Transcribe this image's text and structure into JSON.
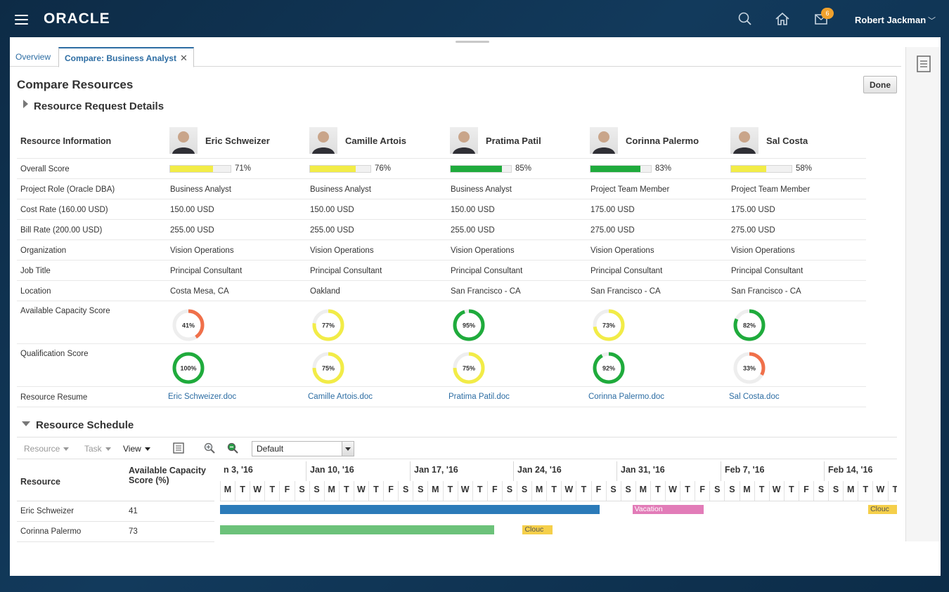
{
  "header": {
    "logo": "ORACLE",
    "notification_count": "6",
    "user_name": "Robert Jackman"
  },
  "tabs": [
    {
      "label": "Overview",
      "active": false
    },
    {
      "label": "Compare: Business Analyst",
      "active": true
    }
  ],
  "page": {
    "title": "Compare Resources",
    "done_label": "Done",
    "request_section": "Resource Request Details",
    "schedule_section": "Resource Schedule"
  },
  "compare": {
    "header_label": "Resource Information",
    "row_labels": {
      "overall": "Overall Score",
      "role": "Project Role (Oracle DBA)",
      "cost": "Cost Rate (160.00 USD)",
      "bill": "Bill Rate (200.00 USD)",
      "org": "Organization",
      "job": "Job Title",
      "location": "Location",
      "capacity": "Available Capacity Score",
      "qualification": "Qualification Score",
      "resume": "Resource Resume"
    },
    "resources": [
      {
        "name": "Eric Schweizer",
        "overall": 71,
        "overall_label": "71%",
        "overall_color": "#f2ec47",
        "role": "Business Analyst",
        "cost": "150.00 USD",
        "bill": "255.00 USD",
        "org": "Vision Operations",
        "job": "Principal Consultant",
        "location": "Costa Mesa, CA",
        "capacity": 41,
        "capacity_label": "41%",
        "capacity_color": "#f0704a",
        "qualification": 100,
        "qualification_label": "100%",
        "qualification_color": "#1fab3c",
        "resume": "Eric Schweizer.doc"
      },
      {
        "name": "Camille Artois",
        "overall": 76,
        "overall_label": "76%",
        "overall_color": "#f2ec47",
        "role": "Business Analyst",
        "cost": "150.00 USD",
        "bill": "255.00 USD",
        "org": "Vision Operations",
        "job": "Principal Consultant",
        "location": "Oakland",
        "capacity": 77,
        "capacity_label": "77%",
        "capacity_color": "#f2ec47",
        "qualification": 75,
        "qualification_label": "75%",
        "qualification_color": "#f2ec47",
        "resume": "Camille Artois.doc"
      },
      {
        "name": "Pratima Patil",
        "overall": 85,
        "overall_label": "85%",
        "overall_color": "#1fab3c",
        "role": "Business Analyst",
        "cost": "150.00 USD",
        "bill": "255.00 USD",
        "org": "Vision Operations",
        "job": "Principal Consultant",
        "location": "San Francisco - CA",
        "capacity": 95,
        "capacity_label": "95%",
        "capacity_color": "#1fab3c",
        "qualification": 75,
        "qualification_label": "75%",
        "qualification_color": "#f2ec47",
        "resume": "Pratima Patil.doc"
      },
      {
        "name": "Corinna Palermo",
        "overall": 83,
        "overall_label": "83%",
        "overall_color": "#1fab3c",
        "role": "Project Team Member",
        "cost": "175.00 USD",
        "bill": "275.00 USD",
        "org": "Vision Operations",
        "job": "Principal Consultant",
        "location": "San Francisco - CA",
        "capacity": 73,
        "capacity_label": "73%",
        "capacity_color": "#f2ec47",
        "qualification": 92,
        "qualification_label": "92%",
        "qualification_color": "#1fab3c",
        "resume": "Corinna Palermo.doc"
      },
      {
        "name": "Sal Costa",
        "overall": 58,
        "overall_label": "58%",
        "overall_color": "#f2ec47",
        "role": "Project Team Member",
        "cost": "175.00 USD",
        "bill": "275.00 USD",
        "org": "Vision Operations",
        "job": "Principal Consultant",
        "location": "San Francisco - CA",
        "capacity": 82,
        "capacity_label": "82%",
        "capacity_color": "#1fab3c",
        "qualification": 33,
        "qualification_label": "33%",
        "qualification_color": "#f0704a",
        "resume": "Sal Costa.doc"
      }
    ]
  },
  "schedule": {
    "toolbar": {
      "resource": "Resource",
      "task": "Task",
      "view": "View",
      "view_select": "Default"
    },
    "col_resource": "Resource",
    "col_capacity": "Available Capacity Score (%)",
    "rows": [
      {
        "name": "Eric Schweizer",
        "capacity": "41"
      },
      {
        "name": "Corinna Palermo",
        "capacity": "73"
      }
    ],
    "weeks": [
      "n 3, '16",
      "Jan 10, '16",
      "Jan 17, '16",
      "Jan 24, '16",
      "Jan 31, '16",
      "Feb 7, '16",
      "Feb 14, '16"
    ],
    "days": [
      "M",
      "T",
      "W",
      "T",
      "F",
      "S",
      "S",
      "M",
      "T",
      "W",
      "T",
      "F",
      "S",
      "S",
      "M",
      "T",
      "W",
      "T",
      "F",
      "S",
      "S",
      "M",
      "T",
      "W",
      "T",
      "F",
      "S",
      "S",
      "M",
      "T",
      "W",
      "T",
      "F",
      "S",
      "S",
      "M",
      "T",
      "W",
      "T",
      "F",
      "S",
      "S",
      "M",
      "T",
      "W",
      "T"
    ],
    "bars": [
      {
        "row": 0,
        "start": 0,
        "end": 25.6,
        "label": "",
        "color": "#2b7bb9"
      },
      {
        "row": 0,
        "start": 27.8,
        "end": 32.6,
        "label": "Vacation",
        "color": "#e27cb8"
      },
      {
        "row": 0,
        "start": 43.7,
        "end": 46,
        "label": "Clouc",
        "color": "#f5cf4a"
      },
      {
        "row": 1,
        "start": 0,
        "end": 18.5,
        "label": "",
        "color": "#6cc27a"
      },
      {
        "row": 1,
        "start": 20.4,
        "end": 22.4,
        "label": "Clouc",
        "color": "#f5cf4a"
      }
    ]
  }
}
